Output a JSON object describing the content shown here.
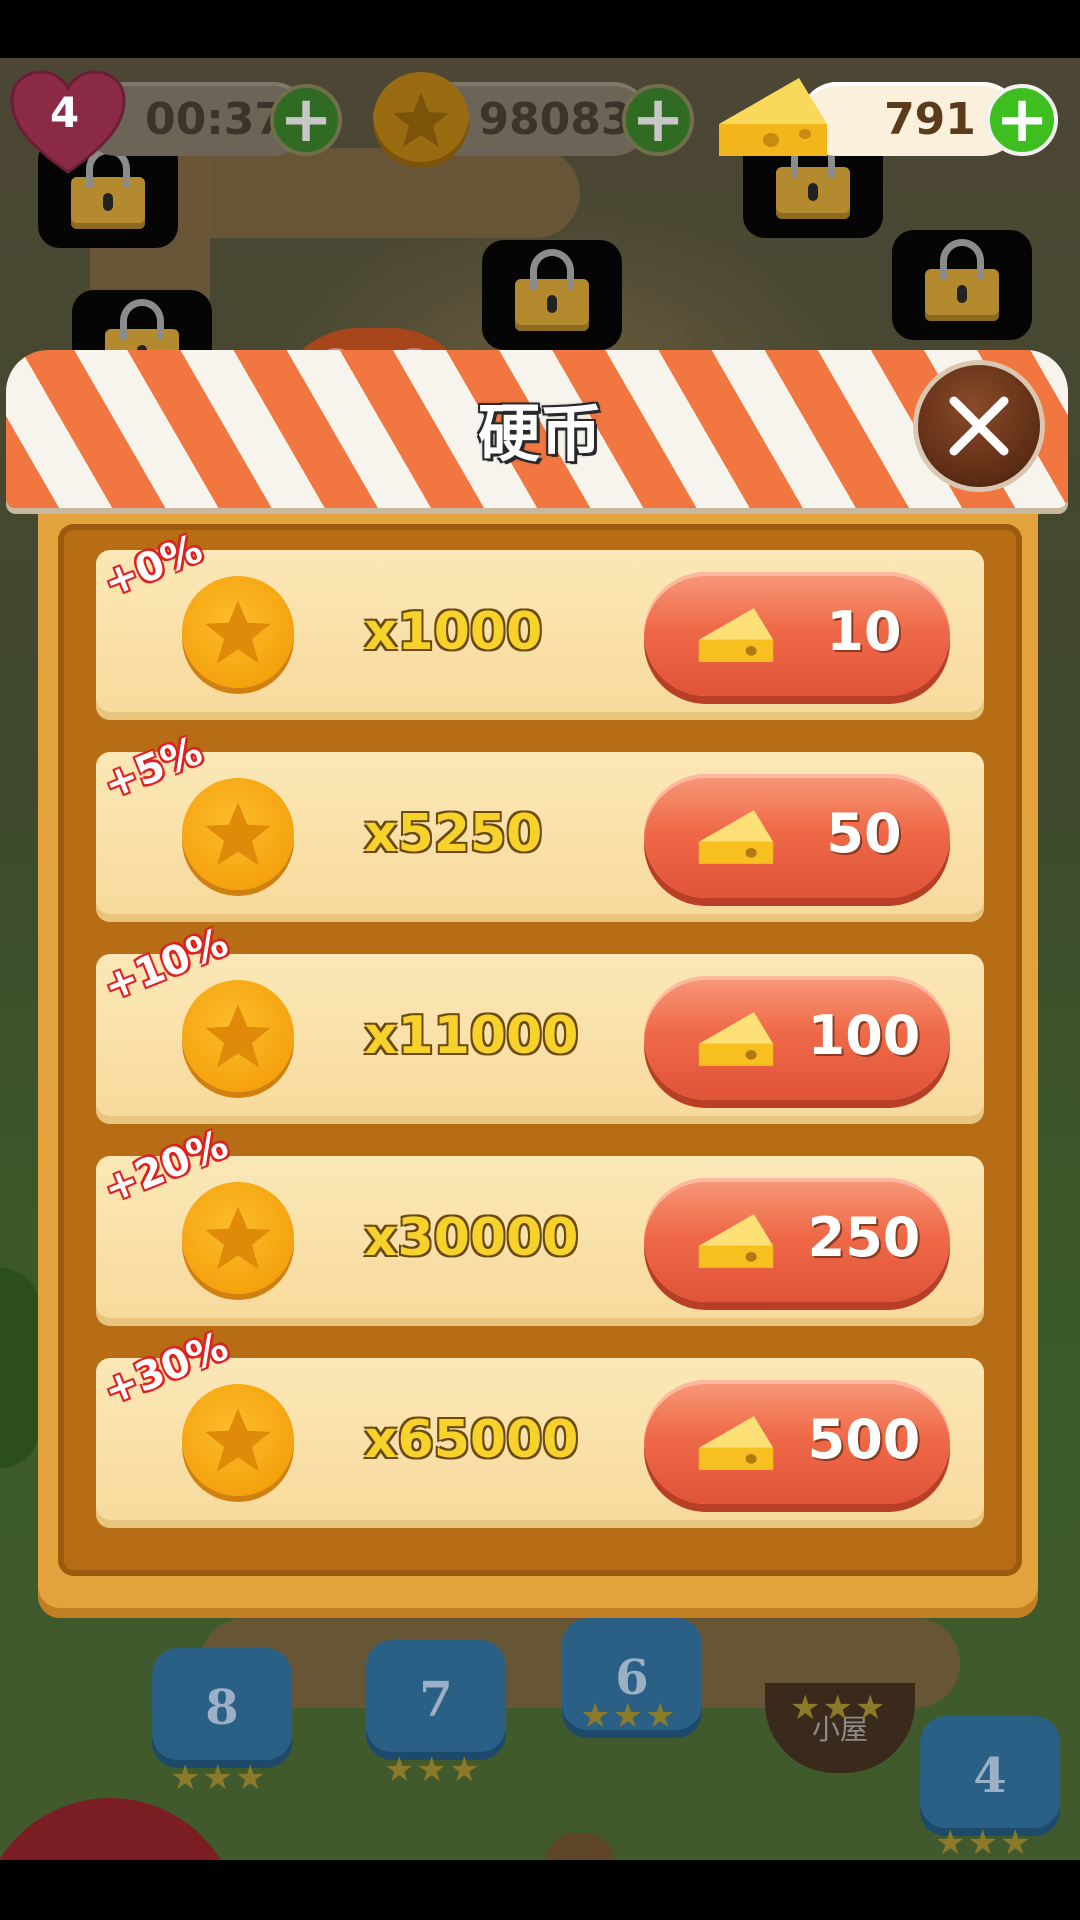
{
  "hud": {
    "lives": "4",
    "timer": "00:37",
    "coins": "98083",
    "cheese": "791"
  },
  "shop": {
    "title": "硬币",
    "items": [
      {
        "bonus": "+0%",
        "amount": "x1000",
        "price": "10"
      },
      {
        "bonus": "+5%",
        "amount": "x5250",
        "price": "50"
      },
      {
        "bonus": "+10%",
        "amount": "x11000",
        "price": "100"
      },
      {
        "bonus": "+20%",
        "amount": "x30000",
        "price": "250"
      },
      {
        "bonus": "+30%",
        "amount": "x65000",
        "price": "500"
      }
    ]
  },
  "map": {
    "levels": [
      "8",
      "7",
      "6",
      "4"
    ],
    "hut_label": "小屋"
  },
  "colors": {
    "awning_orange": "#f1763f",
    "panel_gold": "#e3a23b",
    "buy_button": "#ef6a48",
    "coin_gold": "#f5a30f",
    "bonus_red": "#e02020"
  },
  "icons": [
    "heart-icon",
    "plus-icon",
    "star-coin-icon",
    "cheese-icon",
    "close-icon",
    "lock-icon"
  ]
}
